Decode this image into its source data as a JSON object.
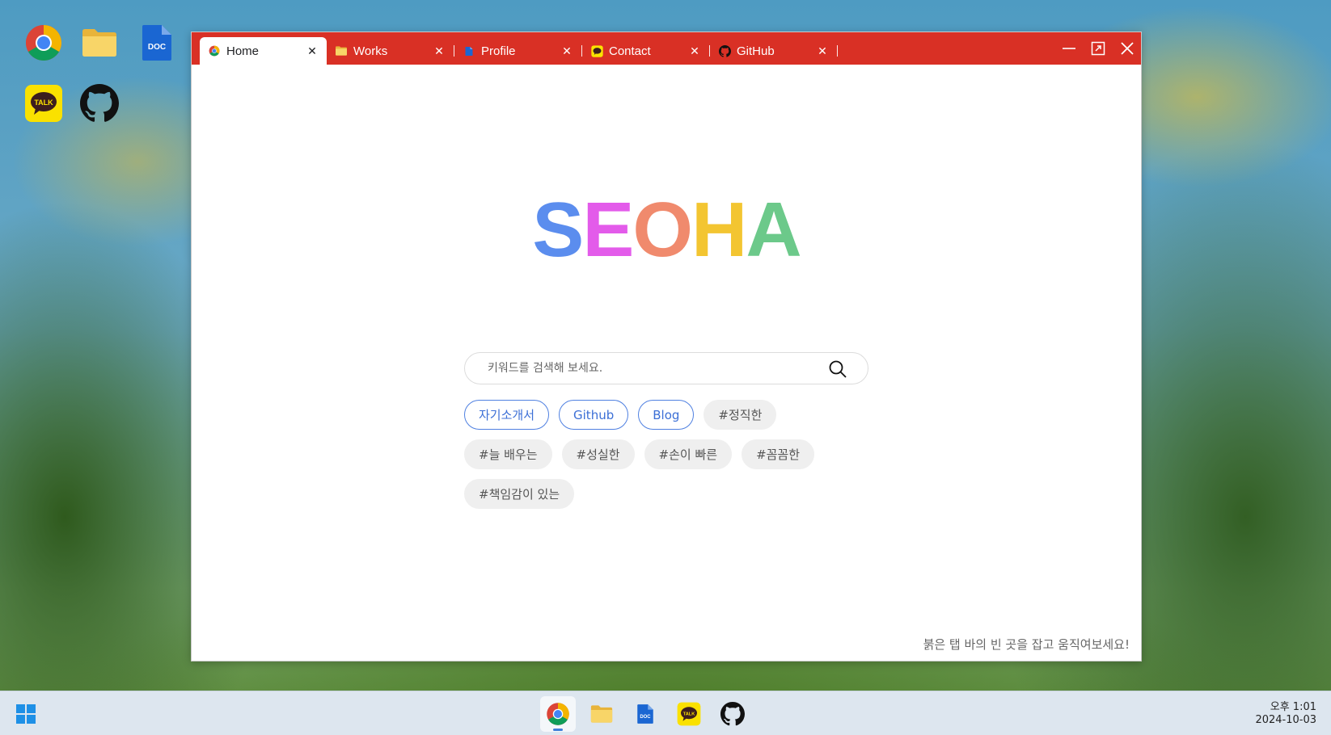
{
  "desktop": {
    "icons": [
      "chrome-icon",
      "folder-icon",
      "doc-icon",
      "kakaotalk-icon",
      "github-icon"
    ]
  },
  "window": {
    "tabs": [
      {
        "label": "Home",
        "icon": "chrome-icon",
        "active": true
      },
      {
        "label": "Works",
        "icon": "folder-icon",
        "active": false
      },
      {
        "label": "Profile",
        "icon": "doc-icon",
        "active": false
      },
      {
        "label": "Contact",
        "icon": "kakaotalk-icon",
        "active": false
      },
      {
        "label": "GitHub",
        "icon": "github-icon",
        "active": false
      }
    ],
    "close_glyph": "✕",
    "controls": [
      "minimize-icon",
      "maximize-icon",
      "close-icon"
    ],
    "tabbar_color": "#d93025"
  },
  "page": {
    "logo": {
      "letters": [
        "S",
        "E",
        "O",
        "H",
        "A"
      ],
      "colors": [
        "#5b8dee",
        "#e35bea",
        "#f08a6d",
        "#f3c531",
        "#6cc98a"
      ]
    },
    "search": {
      "placeholder": "키워드를 검색해 보세요.",
      "value": ""
    },
    "chips": [
      {
        "label": "자기소개서",
        "kind": "link"
      },
      {
        "label": "Github",
        "kind": "link"
      },
      {
        "label": "Blog",
        "kind": "link"
      },
      {
        "label": "#정직한",
        "kind": "tag"
      },
      {
        "label": "#늘 배우는",
        "kind": "tag"
      },
      {
        "label": "#성실한",
        "kind": "tag"
      },
      {
        "label": "#손이 빠른",
        "kind": "tag"
      },
      {
        "label": "#꼼꼼한",
        "kind": "tag"
      },
      {
        "label": "#책임감이 있는",
        "kind": "tag"
      }
    ],
    "hint": "붉은 탭 바의 빈 곳을 잡고 움직여보세요!"
  },
  "taskbar": {
    "start": "windows-icon",
    "apps": [
      "chrome-icon",
      "folder-icon",
      "doc-icon",
      "kakaotalk-icon",
      "github-icon"
    ],
    "active_app": "chrome-icon",
    "time": "오후 1:01",
    "date": "2024-10-03",
    "accent": "#3f7fd9"
  }
}
